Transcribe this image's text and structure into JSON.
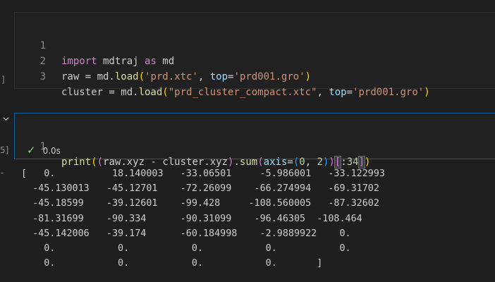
{
  "cell1": {
    "exec_label": "]",
    "lines": [
      {
        "num": "1"
      },
      {
        "num": "2"
      },
      {
        "num": "3"
      }
    ]
  },
  "cell2": {
    "exec_label": "5]",
    "line_num": "1",
    "status_time": "0.0s"
  },
  "output": {
    "bullet": "-",
    "text": "[   0.          18.140003   -33.06501     -5.986001   -33.122993\n  -45.130013   -45.12701    -72.26099    -66.274994   -69.31702\n  -45.18599    -39.12601    -99.428     -108.560005   -87.32602\n  -81.31699    -90.334      -90.31099    -96.46305  -108.464\n  -45.142006   -39.174      -60.184998    -2.9889922    0.\n    0.           0.           0.           0.           0.\n    0.           0.           0.           0.       ]"
  },
  "icons": {
    "chevron": "chevron-down-icon",
    "check": "check-icon"
  }
}
